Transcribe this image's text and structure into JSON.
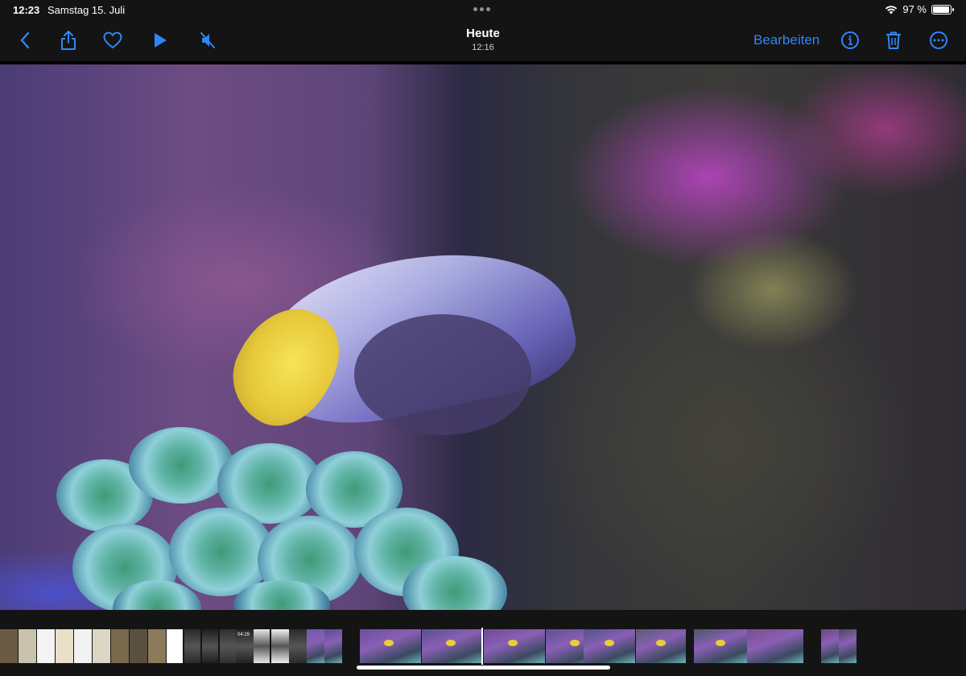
{
  "status_bar": {
    "time": "12:23",
    "date": "Samstag 15. Juli",
    "battery_text": "97 %",
    "battery_level": 0.97
  },
  "nav_bar": {
    "title": "Heute",
    "subtitle": "12:16",
    "edit_label": "Bearbeiten",
    "icons": [
      "back-chevron-icon",
      "share-icon",
      "heart-icon",
      "play-icon",
      "muted-speaker-icon",
      "info-icon",
      "trash-icon",
      "more-icon"
    ],
    "accent_color": "#2f86f7"
  },
  "filmstrip": {
    "thumbnail_time_label": "04:29",
    "thumbnails": [
      {
        "kind": "photo",
        "color": "#6b5b45"
      },
      {
        "kind": "photo",
        "color": "#c9c2ad"
      },
      {
        "kind": "drawing",
        "color": "#f4f4f4"
      },
      {
        "kind": "drawing",
        "color": "#e8e0c8"
      },
      {
        "kind": "drawing",
        "color": "#f2f2f2"
      },
      {
        "kind": "drawing",
        "color": "#ddd6c4"
      },
      {
        "kind": "photo",
        "color": "#7a6a4d"
      },
      {
        "kind": "photo",
        "color": "#5a5040"
      },
      {
        "kind": "photo",
        "color": "#8c7a5a"
      },
      {
        "kind": "document",
        "color": "#ffffff"
      },
      {
        "kind": "screenshot",
        "color": "#2a2a2a"
      },
      {
        "kind": "screenshot",
        "color": "#1e1e1e"
      },
      {
        "kind": "screenshot",
        "color": "#303030"
      },
      {
        "kind": "screenshot",
        "color": "#222222"
      },
      {
        "kind": "screenshot",
        "color": "#e6e6e6"
      },
      {
        "kind": "screenshot",
        "color": "#f0f0f0"
      },
      {
        "kind": "screenshot",
        "color": "#2b2b2b"
      },
      {
        "kind": "aquarium",
        "color": "#6b5aa8"
      },
      {
        "kind": "aquarium",
        "color": "#5a4e96"
      },
      {
        "kind": "aquarium-video",
        "color": "#6a4f9a"
      },
      {
        "kind": "aquarium-video",
        "color": "#58508e"
      },
      {
        "kind": "aquarium-video",
        "color": "#6e4c94"
      },
      {
        "kind": "aquarium-video",
        "color": "#5c5290"
      },
      {
        "kind": "aquarium-video",
        "color": "#4e5486"
      },
      {
        "kind": "aquarium-video",
        "color": "#585c72"
      },
      {
        "kind": "aquarium-video",
        "color": "#4a5868"
      },
      {
        "kind": "aquarium",
        "color": "#7a4e90"
      },
      {
        "kind": "aquarium",
        "color": "#6a4880"
      },
      {
        "kind": "aquarium",
        "color": "#4a4a5a"
      }
    ]
  }
}
